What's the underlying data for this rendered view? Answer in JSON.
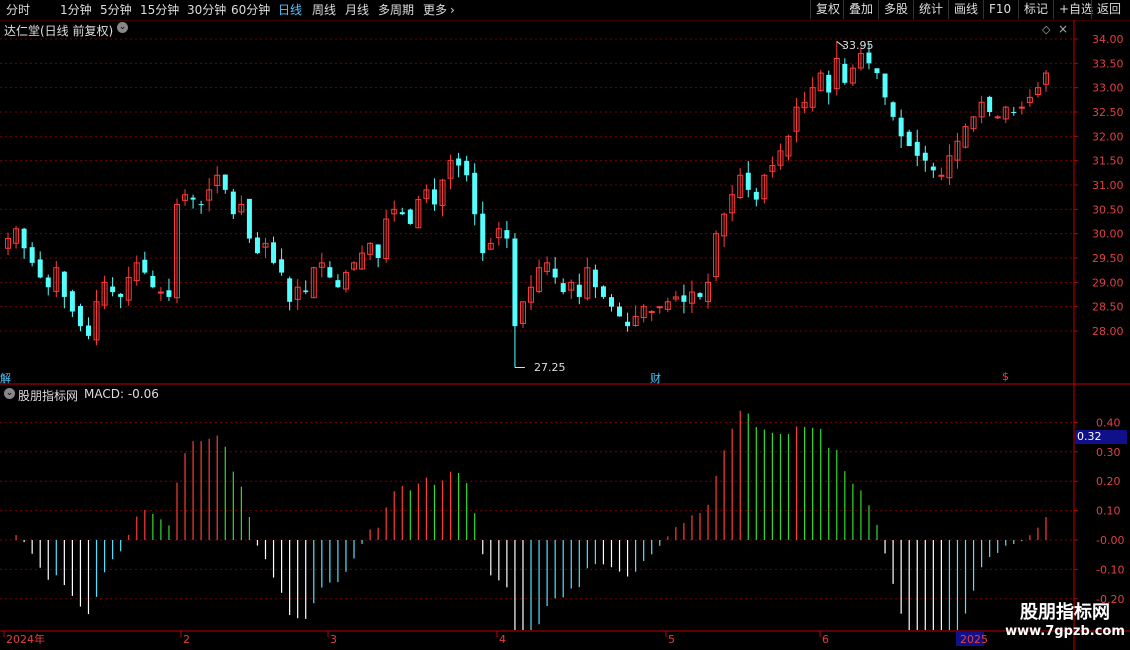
{
  "toolbar": {
    "periods": [
      "分时",
      "1分钟",
      "5分钟",
      "15分钟",
      "30分钟",
      "60分钟",
      "日线",
      "周线",
      "月线",
      "多周期",
      "更多"
    ],
    "active_period": "日线",
    "more_arrow": "›",
    "right_buttons": [
      "复权",
      "叠加",
      "多股",
      "统计",
      "画线",
      "F10",
      "标记",
      "+自选",
      "返回"
    ]
  },
  "main_panel": {
    "title": "达仁堂(日线 前复权)",
    "collapse_icon": "chevron-down-icon",
    "diamond_icon": "diamond-icon",
    "close_icon": "close-icon",
    "high_marker": "33.95",
    "low_marker": "27.25",
    "left_marker": "解",
    "marker_cai": "财",
    "marker_dollar": "$",
    "price_ticks": [
      "34.00",
      "33.50",
      "33.00",
      "32.50",
      "32.00",
      "31.50",
      "31.00",
      "30.50",
      "30.00",
      "29.50",
      "29.00",
      "28.50",
      "28.00"
    ]
  },
  "indicator_panel": {
    "title": "股朋指标网",
    "macd_label": "MACD: -0.06",
    "current_value": "0.32",
    "ticks": [
      "0.40",
      "0.30",
      "0.20",
      "0.10",
      "-0.00",
      "-0.10",
      "-0.20"
    ]
  },
  "date_axis": {
    "labels": [
      "2024年",
      "2",
      "3",
      "4",
      "5",
      "6",
      "2025"
    ]
  },
  "watermark": {
    "title": "股朋指标网",
    "url": "www.7gpzb.com"
  },
  "colors": {
    "up": "#ff3b3b",
    "down": "#54ffff",
    "hist_pos_rise": "#ff3b3b",
    "hist_pos_fall": "#2fdc2f",
    "hist_neg_fall": "#ffffff",
    "hist_neg_rise": "#54e0ff",
    "grid": "#7a0000",
    "axis": "#c00000"
  },
  "chart_data": {
    "type": "candlestick",
    "price_range": [
      27.25,
      33.95
    ],
    "high": 33.95,
    "low": 27.25,
    "closes": [
      29.9,
      30.1,
      29.7,
      29.4,
      29.1,
      28.9,
      29.3,
      28.7,
      28.4,
      28.1,
      27.9,
      28.6,
      29.0,
      28.8,
      28.7,
      29.1,
      29.4,
      29.2,
      28.9,
      28.8,
      28.7,
      30.6,
      30.8,
      30.7,
      30.6,
      30.9,
      31.2,
      30.9,
      30.4,
      30.6,
      29.9,
      29.6,
      29.8,
      29.4,
      29.2,
      28.6,
      28.9,
      28.8,
      29.3,
      29.4,
      29.1,
      28.9,
      29.2,
      29.4,
      29.6,
      29.8,
      29.5,
      30.3,
      30.5,
      30.4,
      30.2,
      30.7,
      30.9,
      30.6,
      31.1,
      31.5,
      31.4,
      31.2,
      30.4,
      29.6,
      29.8,
      30.1,
      29.9,
      28.1,
      28.6,
      28.9,
      29.3,
      29.4,
      29.1,
      28.8,
      29.0,
      28.7,
      29.3,
      28.9,
      28.7,
      28.5,
      28.3,
      28.1,
      28.3,
      28.5,
      28.4,
      28.5,
      28.6,
      28.7,
      28.6,
      28.8,
      28.7,
      29.0,
      30.0,
      30.4,
      30.8,
      31.2,
      30.9,
      30.7,
      31.2,
      31.4,
      31.7,
      32.0,
      32.6,
      32.7,
      33.0,
      33.3,
      32.9,
      33.6,
      33.1,
      33.4,
      33.7,
      33.5,
      33.3,
      32.8,
      32.4,
      32.0,
      31.8,
      31.6,
      31.5,
      31.3,
      31.2,
      31.6,
      31.9,
      32.2,
      32.4,
      32.7,
      32.5,
      32.4,
      32.6,
      32.5,
      32.6,
      32.8,
      33.0,
      33.3
    ]
  }
}
